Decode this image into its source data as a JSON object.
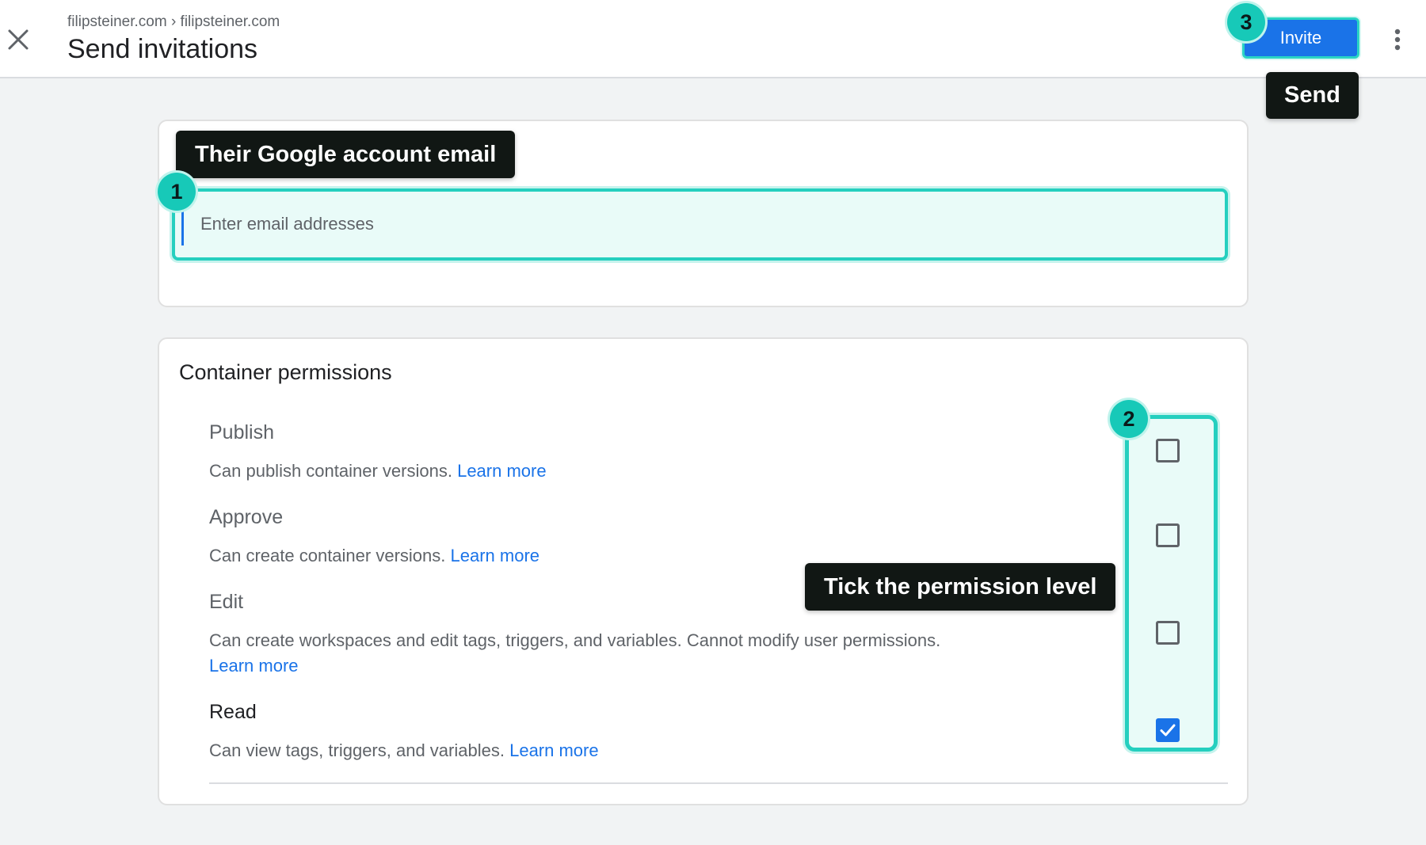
{
  "header": {
    "breadcrumb": "filipsteiner.com › filipsteiner.com",
    "title": "Send invitations",
    "invite_label": "Invite"
  },
  "email": {
    "placeholder": "Enter email addresses"
  },
  "permissions": {
    "section_title": "Container permissions",
    "items": [
      {
        "name": "Publish",
        "desc": "Can publish container versions.",
        "link": "Learn more",
        "checked": false
      },
      {
        "name": "Approve",
        "desc": "Can create container versions.",
        "link": "Learn more",
        "checked": false
      },
      {
        "name": "Edit",
        "desc": "Can create workspaces and edit tags, triggers, and variables. Cannot modify user permissions.",
        "link": "Learn more",
        "checked": false
      },
      {
        "name": "Read",
        "desc": "Can view tags, triggers, and variables.",
        "link": "Learn more",
        "checked": true
      }
    ]
  },
  "annotations": {
    "step1": "1",
    "step2": "2",
    "step3": "3",
    "email_tip": "Their Google account email",
    "permission_tip": "Tick the permission level",
    "send_tip": "Send"
  },
  "icons": {
    "close": "close-icon",
    "more": "more-vert-icon",
    "check": "check-icon"
  },
  "colors": {
    "accent": "#1a73e8",
    "highlight": "#25cfbf",
    "tooltip_bg": "#111714"
  }
}
